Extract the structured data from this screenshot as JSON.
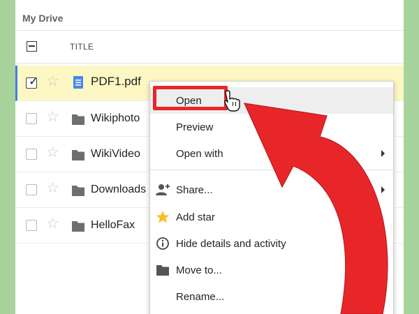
{
  "breadcrumb": "My Drive",
  "list_header": {
    "title_column": "TITLE"
  },
  "files": [
    {
      "name": "PDF1.pdf",
      "type": "pdf",
      "selected": true
    },
    {
      "name": "Wikiphoto",
      "type": "folder",
      "selected": false
    },
    {
      "name": "WikiVideo",
      "type": "folder",
      "selected": false
    },
    {
      "name": "Downloads",
      "type": "folder",
      "selected": false
    },
    {
      "name": "HelloFax",
      "type": "folder",
      "selected": false
    }
  ],
  "context_menu": {
    "items": [
      {
        "label": "Open",
        "icon": null,
        "highlighted": true
      },
      {
        "label": "Preview",
        "icon": null
      },
      {
        "label": "Open with",
        "icon": null,
        "submenu": true
      },
      {
        "label": "Share...",
        "icon": "person-add-icon",
        "submenu": true
      },
      {
        "label": "Add star",
        "icon": "star-icon"
      },
      {
        "label": "Hide details and activity",
        "icon": "info-icon"
      },
      {
        "label": "Move to...",
        "icon": "folder-icon"
      },
      {
        "label": "Rename...",
        "icon": null
      }
    ]
  },
  "colors": {
    "background": "#a9d39c",
    "selected_row": "#fdf7c3",
    "selection_bar": "#3f7ee8",
    "annotation_red": "#e8262a",
    "pdf_icon": "#4a86e8",
    "folder_icon": "#6e6e6e",
    "star_icon": "#f6c026"
  }
}
